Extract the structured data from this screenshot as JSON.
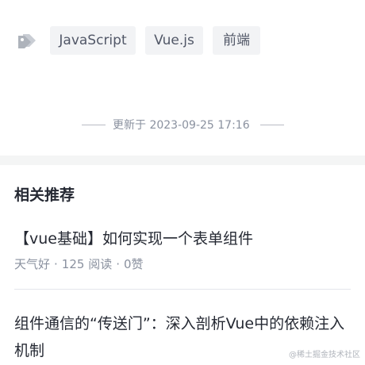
{
  "tags": {
    "icon": "tag-icon",
    "items": [
      {
        "label": "JavaScript"
      },
      {
        "label": "Vue.js"
      },
      {
        "label": "前端"
      }
    ]
  },
  "updated": {
    "text": "更新于 2023-09-25 17:16"
  },
  "related": {
    "title": "相关推荐",
    "items": [
      {
        "title": "【vue基础】如何实现一个表单组件",
        "author": "天气好",
        "views": "125 阅读",
        "likes": "0赞",
        "separator": "·"
      },
      {
        "title": "组件通信的“传送门”：深入剖析Vue中的依赖注入机制"
      }
    ]
  },
  "watermark": "@稀土掘金技术社区",
  "colors": {
    "tag_bg": "#f2f3f5",
    "text_primary": "#252933",
    "text_secondary": "#8a919f",
    "band": "#f4f5f5"
  }
}
